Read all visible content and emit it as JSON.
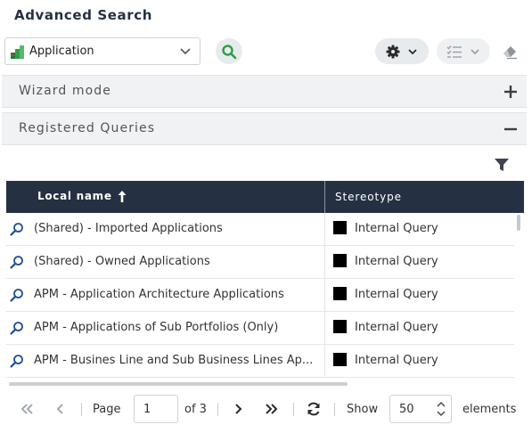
{
  "header": {
    "title": "Advanced Search"
  },
  "toolbar": {
    "type_select": {
      "value": "Application",
      "icon": "application-icon"
    },
    "search_icon": "search-icon",
    "settings_icon": "gear-icon",
    "list_icon": "checklist-icon",
    "eraser_icon": "eraser-icon"
  },
  "panels": {
    "wizard": {
      "title": "Wizard mode",
      "state": "collapsed",
      "icon": "plus-icon"
    },
    "registered": {
      "title": "Registered Queries",
      "state": "expanded",
      "icon": "minus-icon"
    }
  },
  "grid": {
    "columns": {
      "name": "Local name",
      "sort_icon": "arrow-up-icon",
      "stereotype": "Stereotype"
    },
    "rows": [
      {
        "name": "(Shared) - Imported Applications",
        "stereotype": "Internal Query",
        "swatch": "#000000"
      },
      {
        "name": "(Shared) - Owned Applications",
        "stereotype": "Internal Query",
        "swatch": "#000000"
      },
      {
        "name": "APM - Application Architecture Applications",
        "stereotype": "Internal Query",
        "swatch": "#000000"
      },
      {
        "name": "APM - Applications of Sub Portfolios (Only)",
        "stereotype": "Internal Query",
        "swatch": "#000000"
      },
      {
        "name": "APM - Busines Line and Sub Business Lines Ap...",
        "stereotype": "Internal Query",
        "swatch": "#000000"
      }
    ]
  },
  "pager": {
    "page_label": "Page",
    "page_value": "1",
    "of_label": "of 3",
    "show_label": "Show",
    "show_value": "50",
    "elements_label": "elements"
  },
  "colors": {
    "header_bg": "#253142",
    "accent_green": "#2e9e44",
    "link_blue": "#1f4f8f"
  }
}
